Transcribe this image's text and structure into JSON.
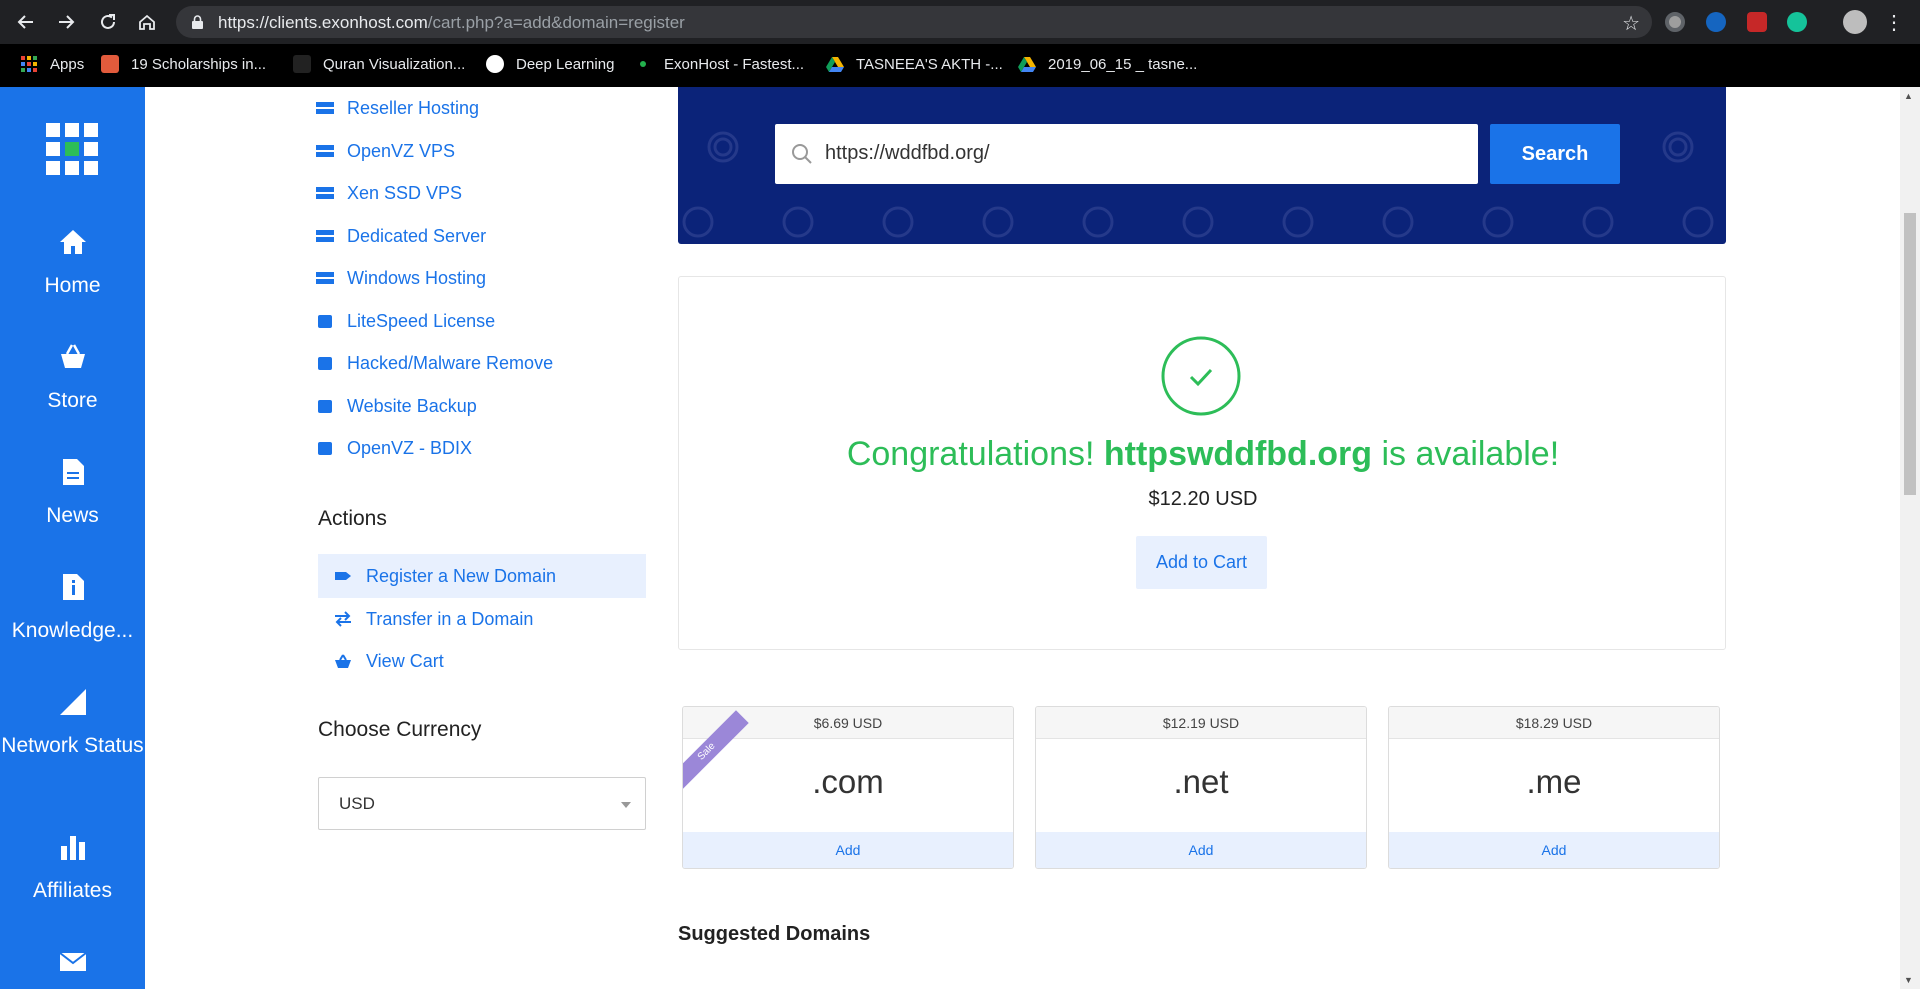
{
  "browser": {
    "url_host": "https://clients.exonhost.com",
    "url_path": "/cart.php?a=add&domain=register",
    "bookmarks": [
      {
        "label": "Apps",
        "color": "#e94235"
      },
      {
        "label": "19 Scholarships in...",
        "color": "#e25b3c"
      },
      {
        "label": "Quran Visualization...",
        "color": "#333333"
      },
      {
        "label": "Deep Learning",
        "color": "#ffffff"
      },
      {
        "label": "ExonHost - Fastest...",
        "color": "#23b14d"
      },
      {
        "label": "TASNEEA'S AKTH -...",
        "color": "#f4b400"
      },
      {
        "label": "2019_06_15 _ tasne...",
        "color": "#f4b400"
      }
    ]
  },
  "sidebar": {
    "items": [
      {
        "label": "Home",
        "icon": "home-icon"
      },
      {
        "label": "Store",
        "icon": "basket-icon"
      },
      {
        "label": "News",
        "icon": "document-icon"
      },
      {
        "label": "Knowledge...",
        "icon": "info-document-icon"
      },
      {
        "label": "Network Status",
        "icon": "signal-icon"
      },
      {
        "label": "Affiliates",
        "icon": "bar-chart-icon"
      },
      {
        "label": "",
        "icon": "envelope-icon"
      }
    ]
  },
  "categories": [
    "Reseller Hosting",
    "OpenVZ VPS",
    "Xen SSD VPS",
    "Dedicated Server",
    "Windows Hosting",
    "LiteSpeed License",
    "Hacked/Malware Remove",
    "Website Backup",
    "OpenVZ - BDIX"
  ],
  "actions": {
    "title": "Actions",
    "items": [
      "Register a New Domain",
      "Transfer in a Domain",
      "View Cart"
    ]
  },
  "currency": {
    "title": "Choose Currency",
    "value": "USD"
  },
  "search": {
    "value": "https://wddfbd.org/",
    "button": "Search"
  },
  "result": {
    "prefix": "Congratulations!",
    "domain": "httpswddfbd.org",
    "suffix": "is available!",
    "price": "$12.20 USD",
    "add_label": "Add to Cart"
  },
  "tlds": [
    {
      "price": "$6.69 USD",
      "name": ".com",
      "add": "Add",
      "badge": "Sale"
    },
    {
      "price": "$12.19 USD",
      "name": ".net",
      "add": "Add",
      "badge": ""
    },
    {
      "price": "$18.29 USD",
      "name": ".me",
      "add": "Add",
      "badge": ""
    }
  ],
  "suggested_title": "Suggested Domains",
  "colors": {
    "primary": "#1a73e8",
    "success": "#2dbd58",
    "banner": "#0b2379"
  }
}
